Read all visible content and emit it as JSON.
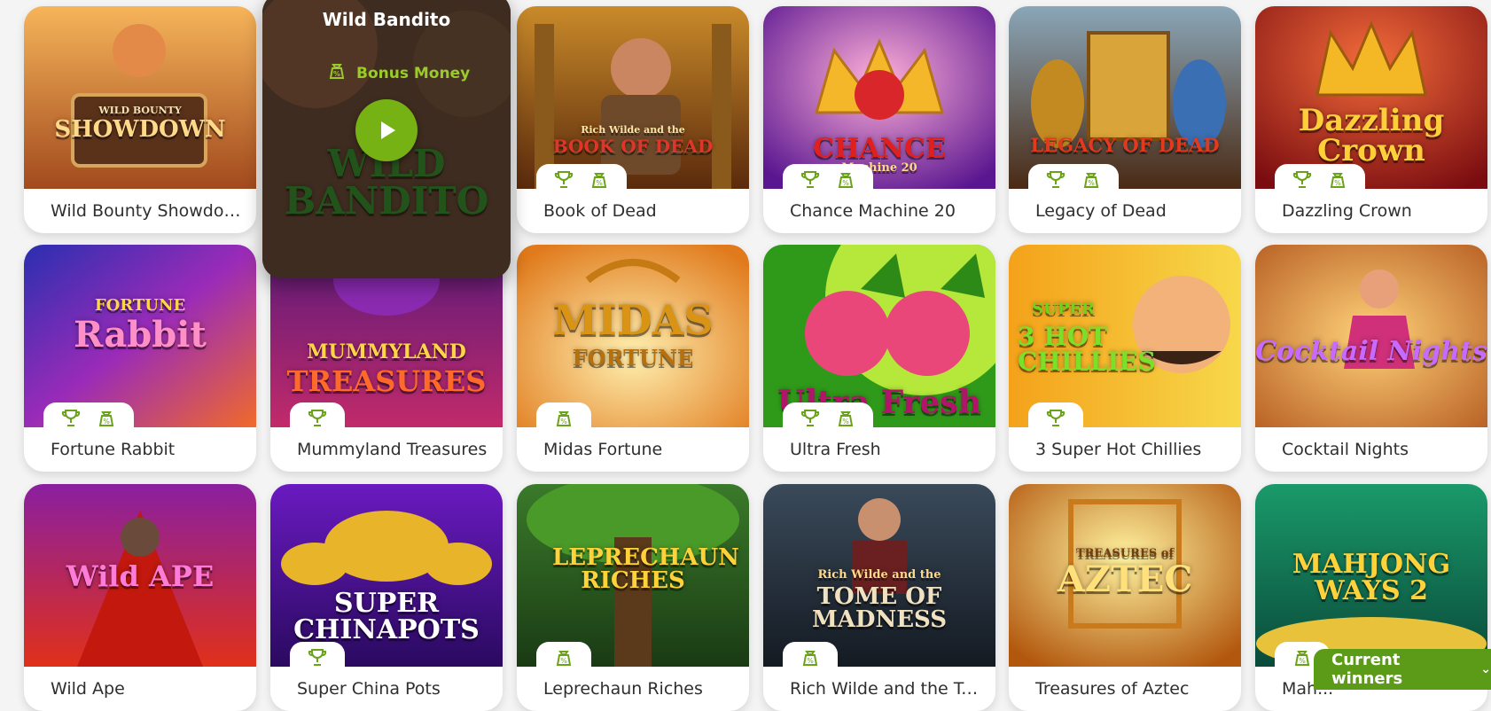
{
  "hover_game": {
    "title": "Wild Bandito",
    "bonus_label": "Bonus Money",
    "art_text": "WILD BANDITO"
  },
  "games": [
    {
      "title": "Wild Bounty Showdown",
      "art": "SHOWDOWN",
      "art_sub": "WILD BOUNTY",
      "badges": []
    },
    {
      "title": "Book of Dead",
      "art": "BOOK OF DEAD",
      "art_sub": "Rich Wilde and the",
      "badges": [
        "trophy",
        "bonus"
      ]
    },
    {
      "title": "Chance Machine 20",
      "art": "CHANCE",
      "art_sub": "Machine 20",
      "badges": [
        "trophy",
        "bonus"
      ]
    },
    {
      "title": "Legacy of Dead",
      "art": "LEGACY OF DEAD",
      "art_sub": "",
      "badges": [
        "trophy",
        "bonus"
      ]
    },
    {
      "title": "Dazzling Crown",
      "art": "Dazzling Crown",
      "art_sub": "",
      "badges": [
        "trophy",
        "bonus"
      ]
    },
    {
      "title": "Fortune Rabbit",
      "art": "Rabbit",
      "art_sub": "FORTUNE",
      "badges": [
        "trophy",
        "bonus"
      ]
    },
    {
      "title": "Mummyland Treasures",
      "art": "TREASURES",
      "art_sub": "MUMMYLAND",
      "badges": [
        "trophy"
      ]
    },
    {
      "title": "Midas Fortune",
      "art": "MIDAS",
      "art_sub": "FORTUNE",
      "badges": [
        "bonus"
      ]
    },
    {
      "title": "Ultra Fresh",
      "art": "Ultra Fresh",
      "art_sub": "",
      "badges": [
        "trophy",
        "bonus"
      ]
    },
    {
      "title": "3 Super Hot Chillies",
      "art": "3 HOT CHILLIES",
      "art_sub": "SUPER",
      "badges": [
        "trophy"
      ]
    },
    {
      "title": "Cocktail Nights",
      "art": "Cocktail Nights",
      "art_sub": "",
      "badges": []
    },
    {
      "title": "Wild Ape",
      "art": "Wild APE",
      "art_sub": "",
      "badges": []
    },
    {
      "title": "Super China Pots",
      "art": "SUPER CHINAPOTS",
      "art_sub": "",
      "badges": [
        "trophy"
      ]
    },
    {
      "title": "Leprechaun Riches",
      "art": "LEPRECHAUN RICHES",
      "art_sub": "",
      "badges": [
        "bonus"
      ]
    },
    {
      "title": "Rich Wilde and the To...",
      "art": "TOME OF MADNESS",
      "art_sub": "Rich Wilde and the",
      "badges": [
        "bonus"
      ]
    },
    {
      "title": "Treasures of Aztec",
      "art": "AZTEC",
      "art_sub": "TREASURES of",
      "badges": []
    },
    {
      "title": "Mah...",
      "art": "MAHJONG WAYS 2",
      "art_sub": "",
      "badges": [
        "bonus"
      ]
    }
  ],
  "winners_button": "Current winners",
  "theme": {
    "accent": "#76b214",
    "badge_green": "#6aa319",
    "winners_bg": "#5c9b18"
  }
}
